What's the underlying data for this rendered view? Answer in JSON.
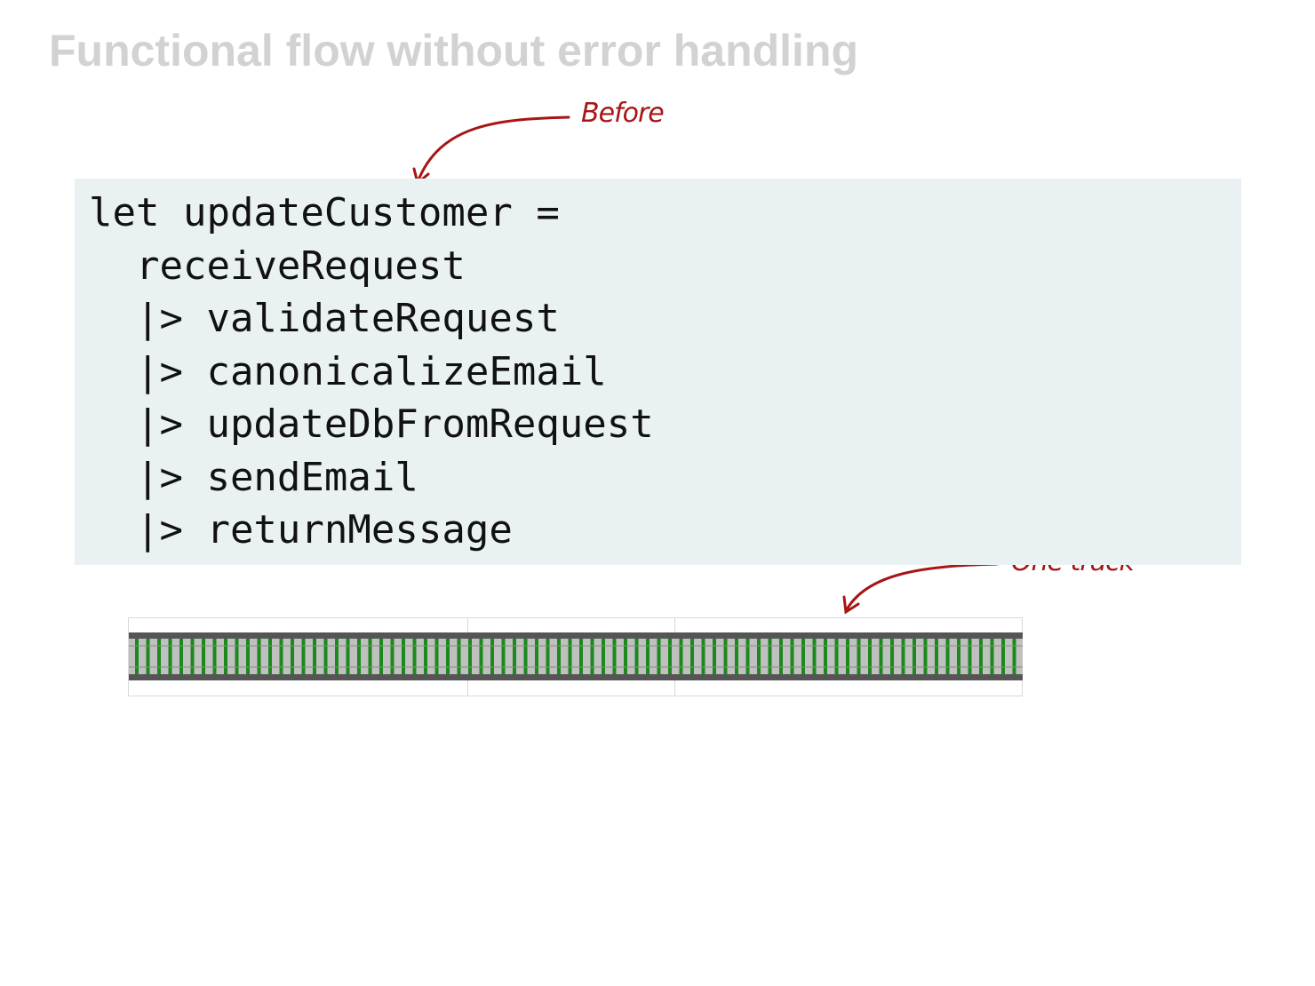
{
  "slide": {
    "title": "Functional flow without error handling"
  },
  "annotations": {
    "before": "Before",
    "one_track": "One track"
  },
  "code": {
    "lines": [
      "let updateCustomer =",
      "  receiveRequest",
      "  |> validateRequest",
      "  |> canonicalizeEmail",
      "  |> updateDbFromRequest",
      "  |> sendEmail",
      "  |> returnMessage"
    ]
  },
  "colors": {
    "title": "#d2d2d2",
    "code_background": "#e9f1f3",
    "annotation": "#a81515",
    "rail": "#555555",
    "rail_bed": "#c0c0c0",
    "sleeper": "#1a8a1a"
  },
  "track": {
    "segments": 3
  }
}
